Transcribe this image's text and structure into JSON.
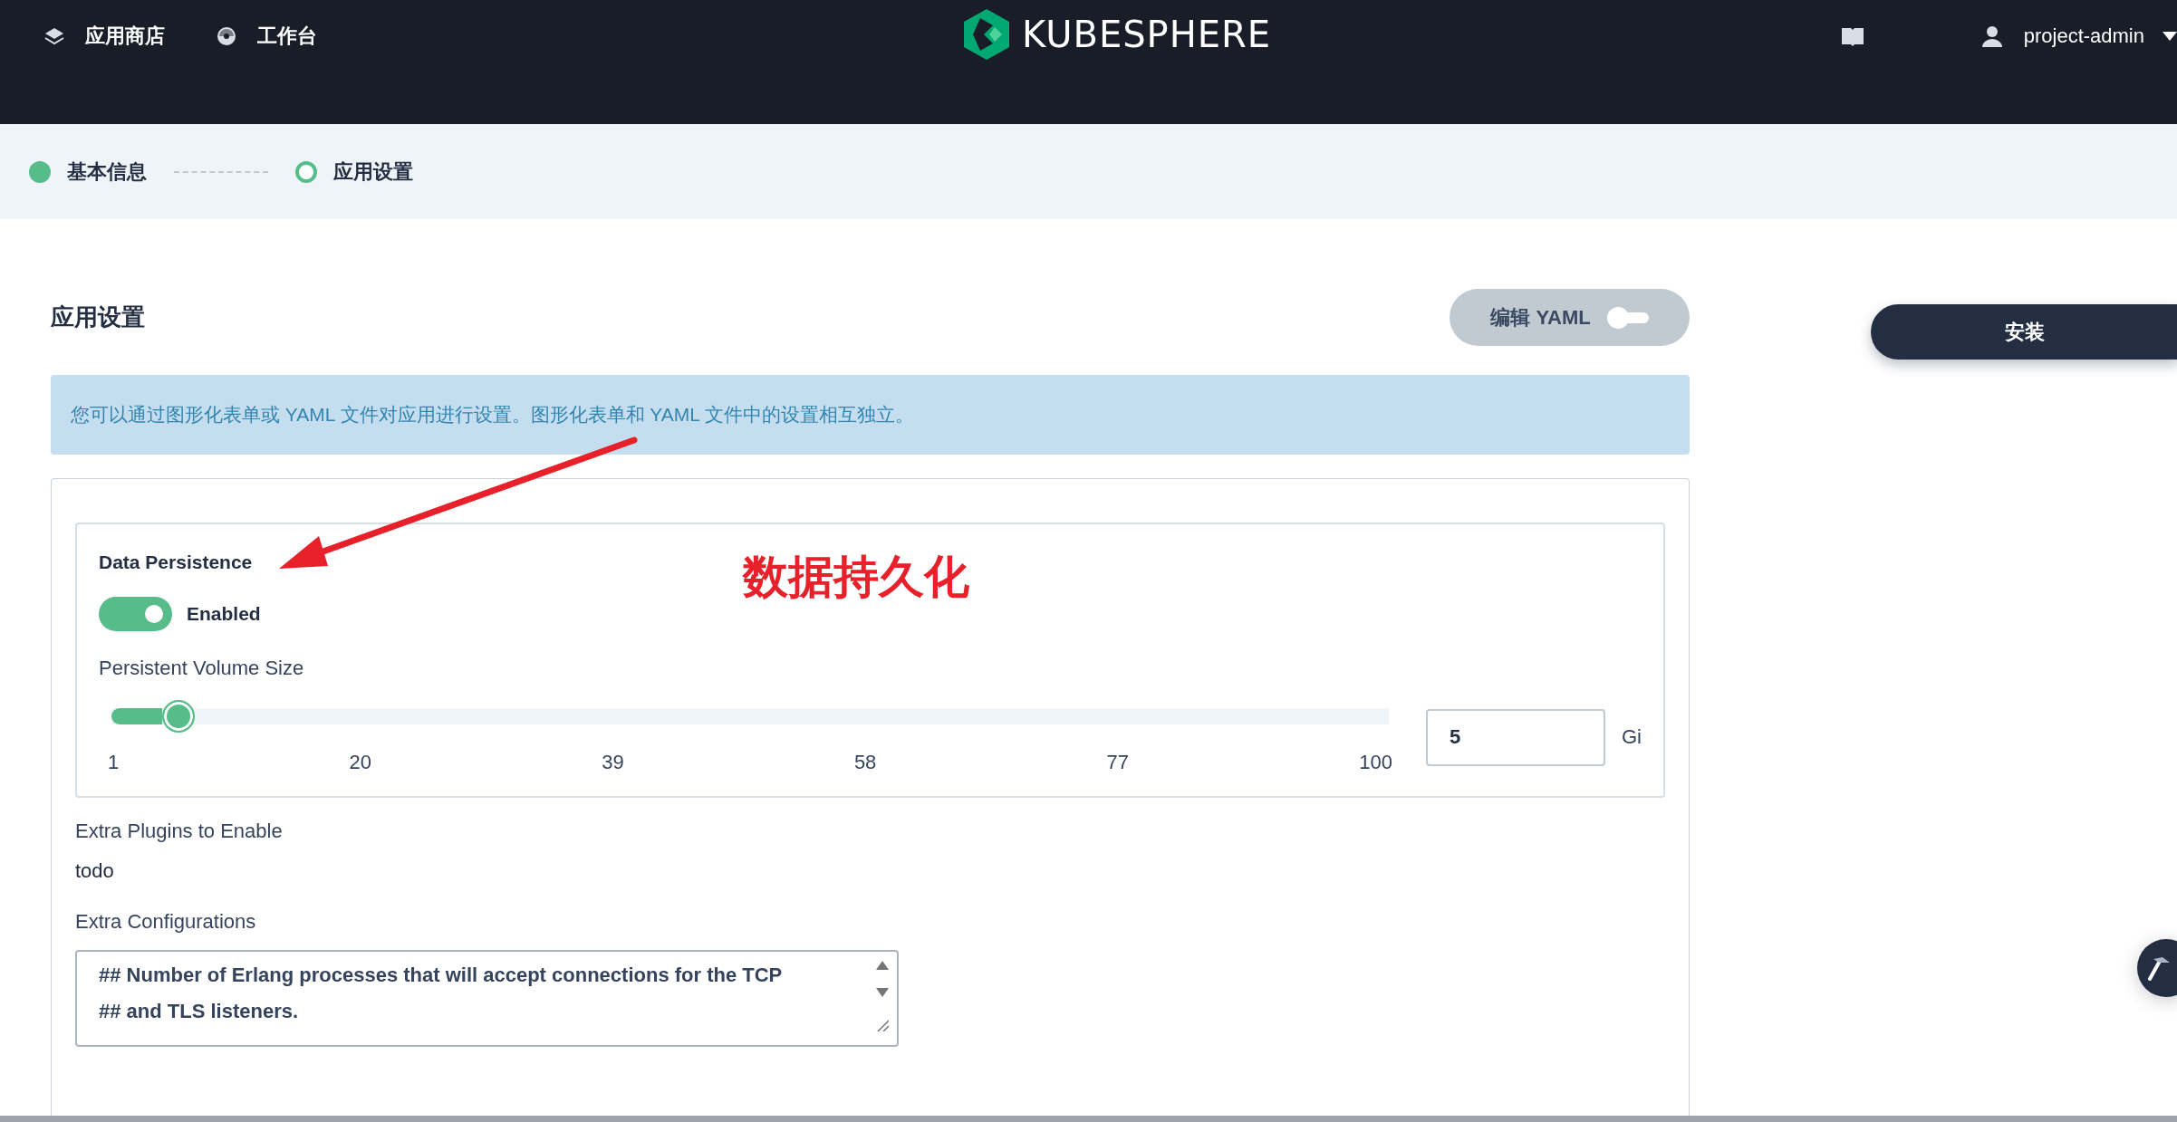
{
  "top_nav": {
    "items": [
      {
        "label": "应用商店",
        "kind": "store"
      },
      {
        "label": "工作台",
        "kind": "workbench"
      }
    ],
    "logo": "KUBESPHERE",
    "user": "project-admin"
  },
  "steps": [
    {
      "label": "基本信息",
      "done": true
    },
    {
      "label": "应用设置",
      "done": false
    }
  ],
  "page_title": "应用设置",
  "yaml_toggle": {
    "label": "编辑 YAML",
    "on": false
  },
  "install_button": "安装",
  "info": "您可以通过图形化表单或 YAML 文件对应用进行设置。图形化表单和 YAML 文件中的设置相互独立。",
  "persistence": {
    "title": "Data Persistence",
    "enabled": true,
    "enabled_label": "Enabled",
    "size_label": "Persistent Volume Size",
    "slider": {
      "level": 0.04,
      "ticks": [
        "1",
        "20",
        "39",
        "58",
        "77",
        "100"
      ]
    },
    "value": "5",
    "unit": "Gi"
  },
  "plugins": {
    "label": "Extra Plugins to Enable",
    "value": "todo"
  },
  "configurations": {
    "label": "Extra Configurations",
    "lines": [
      "## Number of Erlang processes that will accept connections for the TCP",
      "## and TLS listeners."
    ]
  },
  "annotation": "数据持久化"
}
